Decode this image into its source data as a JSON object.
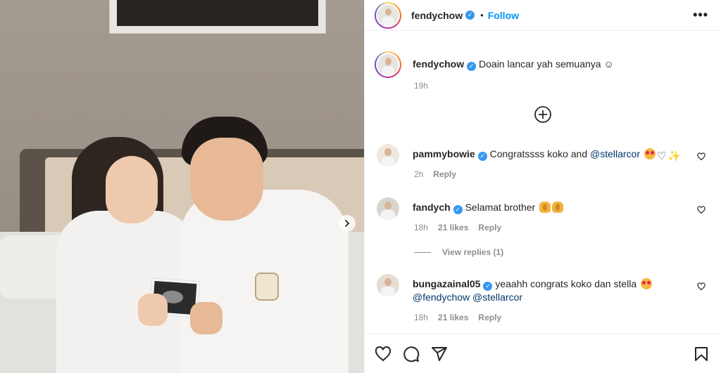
{
  "post": {
    "username": "fendychow",
    "follow_label": "Follow",
    "separator": "•",
    "more_label": "•••"
  },
  "caption": {
    "username": "fendychow",
    "text": "Doain lancar yah semuanya ☺",
    "time": "19h"
  },
  "comments": [
    {
      "username": "pammybowie",
      "text": "Congratssss koko and ",
      "mention": "@stellarcor",
      "time": "2h",
      "reply_label": "Reply"
    },
    {
      "username": "fandych",
      "text": "Selamat brother",
      "time": "18h",
      "likes": "21 likes",
      "reply_label": "Reply"
    },
    {
      "username": "bungazainal05",
      "text": "yeaahh congrats koko dan stella",
      "mention_1": "@fendychow",
      "mention_2": "@stellarcor",
      "time": "18h",
      "likes": "21 likes",
      "reply_label": "Reply"
    }
  ],
  "view_replies_label": "View replies (1)",
  "colors": {
    "link": "#0095f6",
    "verified": "#3897f0",
    "muted": "#8e8e8e",
    "mention": "#00376b"
  },
  "icons": [
    "heart-icon",
    "comment-icon",
    "share-icon",
    "bookmark-icon",
    "add-circle-icon",
    "chevron-right-icon",
    "more-icon",
    "verified-icon"
  ]
}
